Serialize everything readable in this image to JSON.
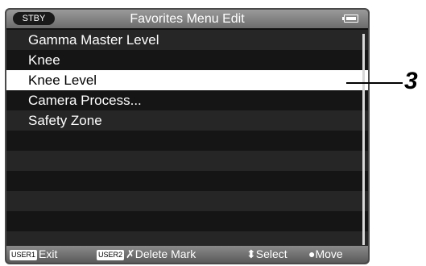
{
  "status": {
    "mode": "STBY",
    "battery_icon": "battery-icon"
  },
  "header": {
    "title": "Favorites Menu Edit"
  },
  "menu": {
    "items": [
      {
        "label": "Gamma Master Level"
      },
      {
        "label": "Knee"
      },
      {
        "label": "Knee Level",
        "selected": true
      },
      {
        "label": "Camera Process..."
      },
      {
        "label": "Safety Zone"
      },
      {
        "label": ""
      },
      {
        "label": ""
      },
      {
        "label": ""
      },
      {
        "label": ""
      },
      {
        "label": ""
      },
      {
        "label": ""
      }
    ]
  },
  "footer": {
    "user1_badge": "USER1",
    "user1_action": "Exit",
    "user2_badge": "USER2",
    "user2_action": "✗Delete Mark",
    "select_action": "⬍Select",
    "move_action": "●Move"
  },
  "callout": {
    "number": "3"
  }
}
